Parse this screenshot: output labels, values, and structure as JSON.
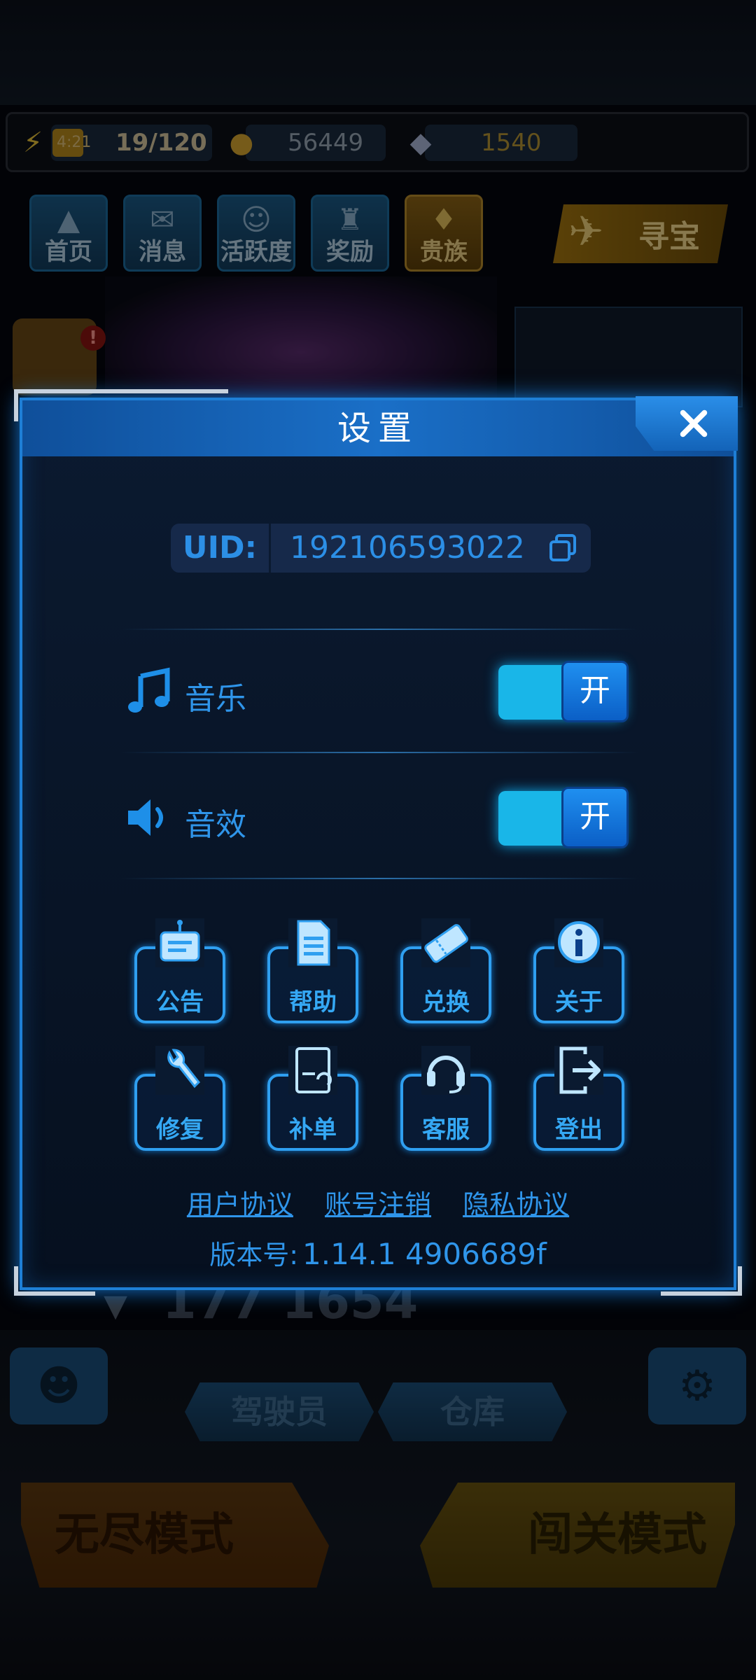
{
  "resources": {
    "time": "4:21",
    "energy": "19/120",
    "coins": "56449",
    "gems": "1540"
  },
  "nav": [
    {
      "label": "首页",
      "icon": "home-icon"
    },
    {
      "label": "消息",
      "icon": "mail-icon"
    },
    {
      "label": "活跃度",
      "icon": "activity-icon"
    },
    {
      "label": "奖励",
      "icon": "reward-icon"
    },
    {
      "label": "贵族",
      "icon": "vip-icon"
    }
  ],
  "treasure_label": "寻宝",
  "background": {
    "score": "177 1654",
    "pilot_label": "驾驶员",
    "warehouse_label": "仓库",
    "endless_mode": "无尽模式",
    "stage_mode": "闯关模式",
    "alert": "!"
  },
  "dialog": {
    "title": "设置",
    "uid_label": "UID:",
    "uid_value": "192106593022",
    "music_label": "音乐",
    "music_state": "开",
    "sfx_label": "音效",
    "sfx_state": "开",
    "buttons": [
      {
        "label": "公告",
        "icon": "announcement-icon"
      },
      {
        "label": "帮助",
        "icon": "help-document-icon"
      },
      {
        "label": "兑换",
        "icon": "ticket-icon"
      },
      {
        "label": "关于",
        "icon": "info-icon"
      },
      {
        "label": "修复",
        "icon": "wrench-icon"
      },
      {
        "label": "补单",
        "icon": "order-supplement-icon"
      },
      {
        "label": "客服",
        "icon": "headset-icon"
      },
      {
        "label": "登出",
        "icon": "logout-icon"
      }
    ],
    "links": [
      "用户协议",
      "账号注销",
      "隐私协议"
    ],
    "version_label": "版本号:",
    "version_value": "1.14.1   4906689f"
  },
  "colors": {
    "accent": "#2f95ea",
    "toggle_on": "#19b6e8",
    "header": "#1a6fc7"
  }
}
